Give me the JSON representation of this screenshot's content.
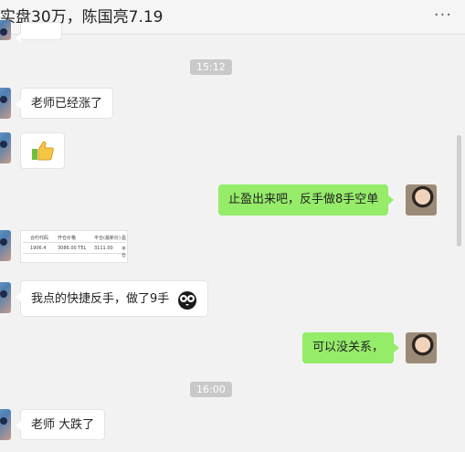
{
  "header": {
    "title": "实盘30万，陈国亮7.19",
    "more_icon": "more-icon"
  },
  "times": {
    "t1": "15:12",
    "t2": "16:00"
  },
  "messages": {
    "m1": "老师已经涨了",
    "m2_icon": "thumbs-up-icon",
    "m3": "止盈出来吧，反手做8手空单",
    "m4_image": "spreadsheet-screenshot",
    "m5": "我点的快捷反手，做了9手",
    "m6": "可以没关系，",
    "m7": "老师 大跌了"
  },
  "sheet": {
    "headers": [
      "合约代码",
      "开仓价格",
      "平仓(最新价)",
      "盈"
    ],
    "values": [
      "1906.4",
      "3086.00 TEL",
      "3111.00",
      "平仓"
    ]
  },
  "colors": {
    "out_bubble": "#95ec69",
    "in_bubble": "#ffffff",
    "background": "#f2f2f2"
  }
}
